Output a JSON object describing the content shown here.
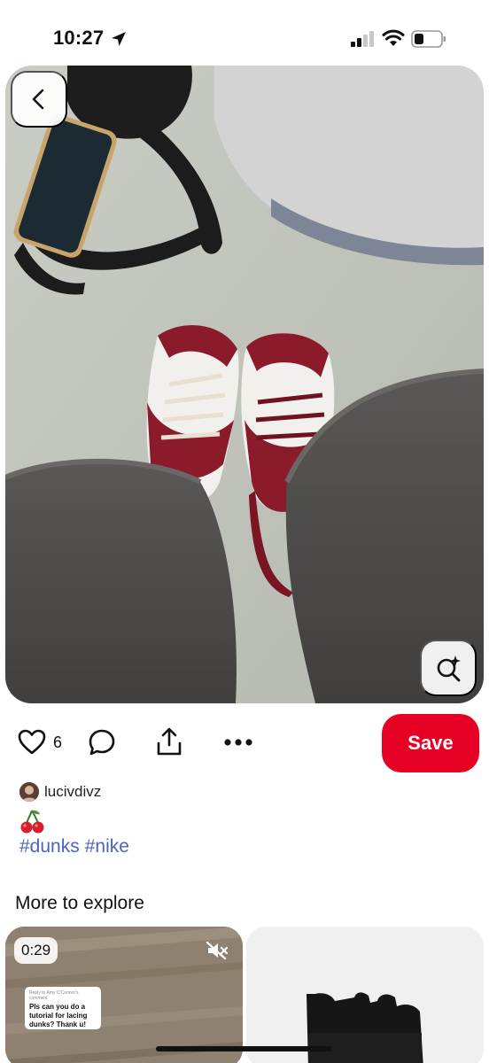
{
  "status_bar": {
    "time": "10:27"
  },
  "pin": {
    "back_icon": "chevron-left-icon",
    "lens_icon": "visual-search-sparkle-icon"
  },
  "actions": {
    "like_icon": "heart-icon",
    "like_count": "6",
    "comment_icon": "comment-bubble-icon",
    "share_icon": "share-icon",
    "more_icon": "ellipsis-icon",
    "save_label": "Save",
    "save_color": "#e60023"
  },
  "creator": {
    "name": "lucivdivz"
  },
  "description": {
    "emoji": "🍒",
    "hashtags": [
      "#dunks",
      "#nike"
    ],
    "hashtag_color": "#4a63c2"
  },
  "explore": {
    "title": "More to explore",
    "cards": [
      {
        "duration": "0:29",
        "mute_icon": "mute-icon",
        "comment_meta": "Reply to Amy O'Connor's comment",
        "comment_text": "Pls can you do a tutorial for lacing dunks? Thank u!"
      },
      {}
    ]
  }
}
